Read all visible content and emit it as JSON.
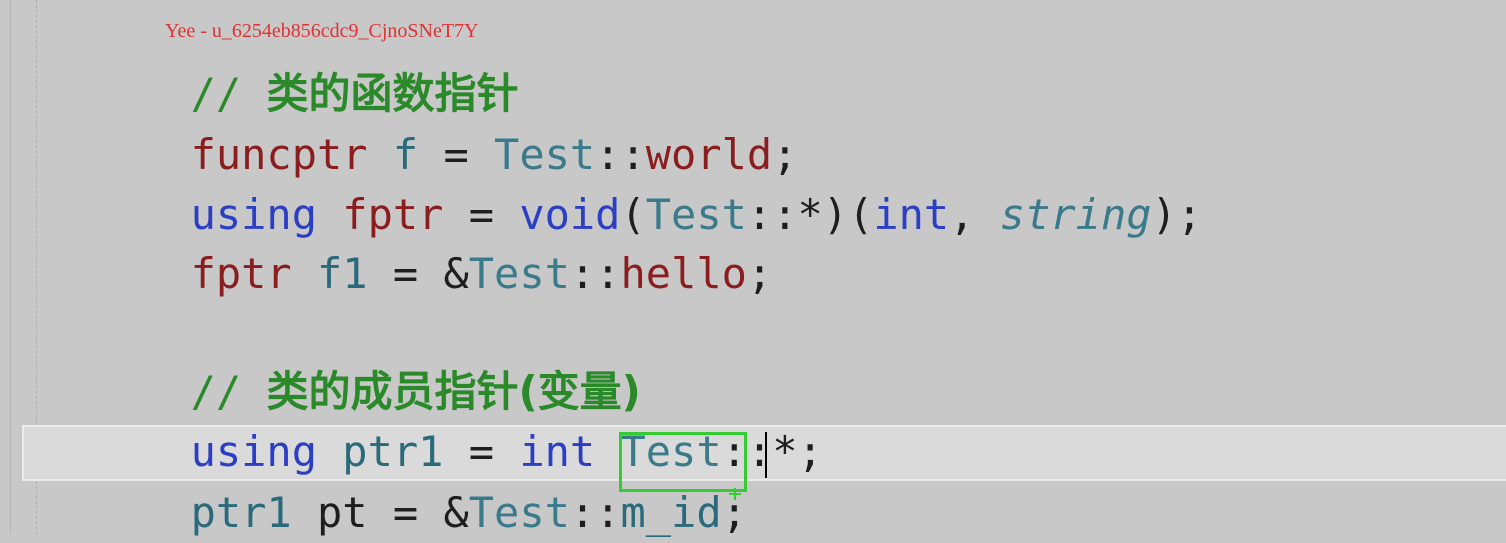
{
  "watermark": "Yee - u_6254eb856cdc9_CjnoSNeT7Y",
  "lines": [
    {
      "comment_slashes": "// ",
      "comment_text": "类的函数指针"
    },
    {
      "t1": "funcptr",
      "t2": " f ",
      "t3": "=",
      "t4": " Test",
      "t5": "::",
      "t6": "world",
      "t7": ";"
    },
    {
      "t1": "using",
      "t2": " fptr ",
      "t3": "=",
      "t4": " void",
      "t5": "(",
      "t6": "Test",
      "t7": "::*)(",
      "t8": "int",
      "t9": ", ",
      "t10": "string",
      "t11": ");"
    },
    {
      "t1": "fptr",
      "t2": " f1 ",
      "t3": "=",
      "t4": " &",
      "t5": "Test",
      "t6": "::",
      "t7": "hello",
      "t8": ";"
    },
    {
      "comment_slashes": "// ",
      "comment_text": "类的成员指针(变量)"
    },
    {
      "t1": "using",
      "t2": " ptr1 ",
      "t3": "=",
      "t4": " int",
      "t5": " Test",
      "t6": "::*;"
    },
    {
      "t1": "ptr1",
      "t2": " pt ",
      "t3": "=",
      "t4": " &",
      "t5": "Test",
      "t6": "::",
      "t7": "m_id",
      "t8": ";"
    }
  ]
}
